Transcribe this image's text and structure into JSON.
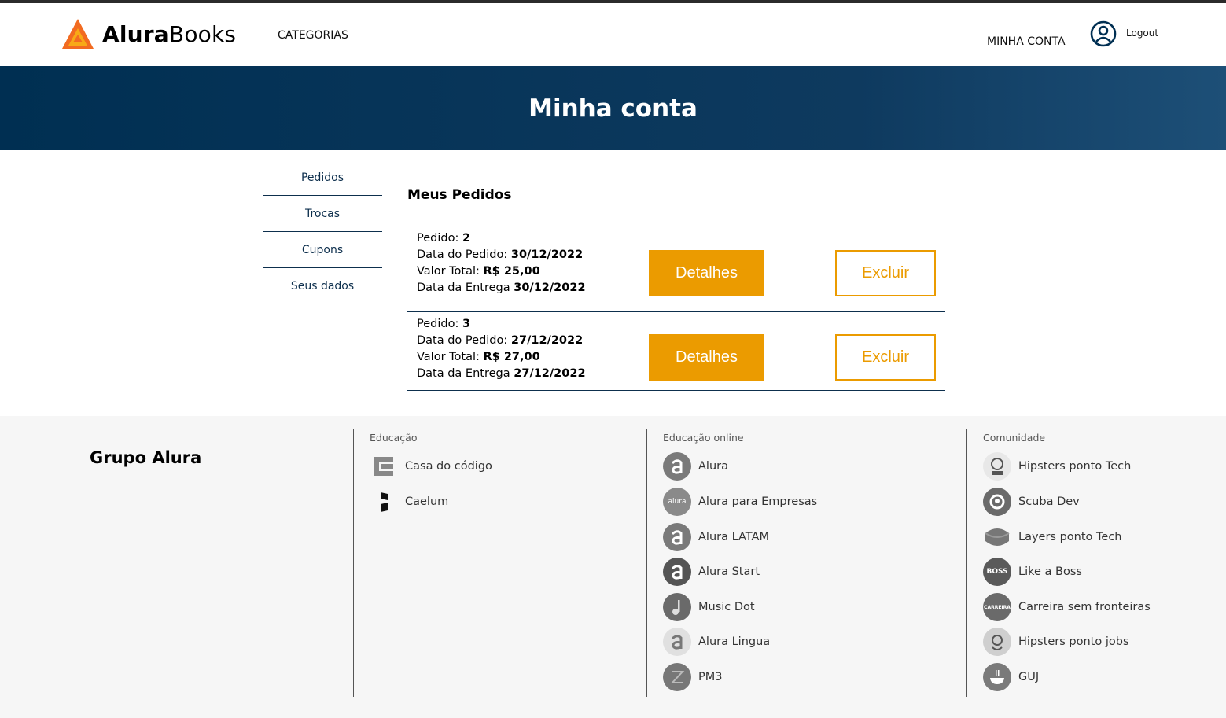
{
  "header": {
    "logo_bold": "Alura",
    "logo_light": "Books",
    "categorias": "CATEGORIAS",
    "minha_conta": "MINHA CONTA",
    "logout": "Logout"
  },
  "banner": {
    "title": "Minha conta"
  },
  "sidebar": {
    "items": [
      {
        "label": "Pedidos"
      },
      {
        "label": "Trocas"
      },
      {
        "label": "Cupons"
      },
      {
        "label": "Seus dados"
      }
    ]
  },
  "orders": {
    "title": "Meus Pedidos",
    "labels": {
      "pedido": "Pedido: ",
      "data_pedido": "Data do Pedido: ",
      "valor_total": "Valor Total: ",
      "data_entrega": "Data da Entrega "
    },
    "detalhes_label": "Detalhes",
    "excluir_label": "Excluir",
    "list": [
      {
        "id": "2",
        "data_pedido": "30/12/2022",
        "valor_total": "R$ 25,00",
        "data_entrega": "30/12/2022"
      },
      {
        "id": "3",
        "data_pedido": "27/12/2022",
        "valor_total": "R$ 27,00",
        "data_entrega": "27/12/2022"
      }
    ]
  },
  "footer": {
    "grupo": "Grupo Alura",
    "educacao": {
      "title": "Educação",
      "links": [
        {
          "label": "Casa do código",
          "icon": "casa-do-codigo-icon"
        },
        {
          "label": "Caelum",
          "icon": "caelum-icon"
        }
      ]
    },
    "educacao_online": {
      "title": "Educação online",
      "links": [
        {
          "label": "Alura",
          "icon": "alura-icon"
        },
        {
          "label": "Alura para Empresas",
          "icon": "alura-empresas-icon",
          "icon_text": "alura"
        },
        {
          "label": "Alura LATAM",
          "icon": "alura-latam-icon"
        },
        {
          "label": "Alura Start",
          "icon": "alura-start-icon"
        },
        {
          "label": "Music Dot",
          "icon": "music-dot-icon"
        },
        {
          "label": "Alura Lingua",
          "icon": "alura-lingua-icon"
        },
        {
          "label": "PM3",
          "icon": "pm3-icon"
        }
      ]
    },
    "comunidade": {
      "title": "Comunidade",
      "links": [
        {
          "label": "Hipsters ponto Tech",
          "icon": "hipsters-tech-icon"
        },
        {
          "label": "Scuba Dev",
          "icon": "scuba-dev-icon"
        },
        {
          "label": "Layers ponto Tech",
          "icon": "layers-tech-icon"
        },
        {
          "label": "Like a Boss",
          "icon": "like-a-boss-icon",
          "icon_text": "BOSS"
        },
        {
          "label": "Carreira sem fronteiras",
          "icon": "carreira-icon",
          "icon_text": "CARREIRA"
        },
        {
          "label": "Hipsters ponto jobs",
          "icon": "hipsters-jobs-icon"
        },
        {
          "label": "GUJ",
          "icon": "guj-icon"
        }
      ]
    }
  },
  "colors": {
    "accent": "#eb9b00",
    "navy": "#002f52",
    "line": "#0d2f4d",
    "footer_bg": "#f6f6f6"
  }
}
